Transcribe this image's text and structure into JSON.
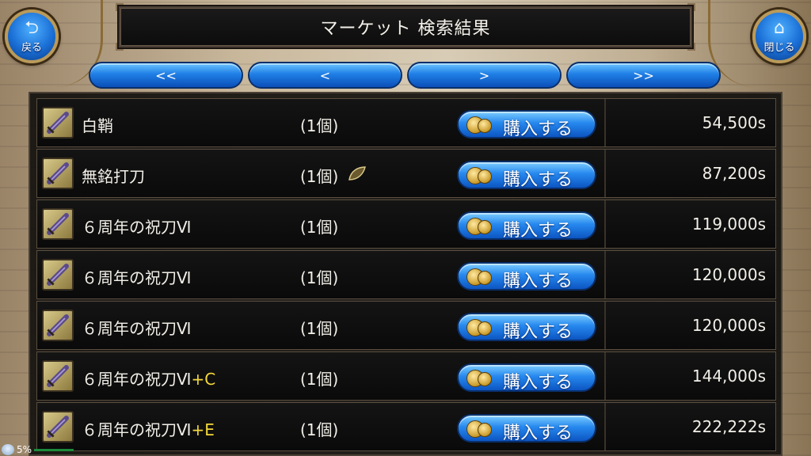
{
  "header": {
    "title": "マーケット 検索結果",
    "back_label": "戻る",
    "close_label": "閉じる"
  },
  "icons": {
    "back": "return-arrow-icon",
    "close": "home-icon",
    "item": "sword-icon",
    "coin": "coin-icon",
    "leaf": "leaf-icon"
  },
  "colors": {
    "button_blue": "#1f7fe6",
    "suffix_yellow": "#f4d83a",
    "row_bg": "#111111"
  },
  "pager": {
    "first": "<<",
    "prev": "<",
    "next": ">",
    "last": ">>"
  },
  "list": {
    "buy_label": "購入する",
    "rows": [
      {
        "name": "白鞘",
        "suffix": "",
        "qty": "(1個)",
        "price": "54,500s",
        "leaf": false
      },
      {
        "name": "無銘打刀",
        "suffix": "",
        "qty": "(1個)",
        "price": "87,200s",
        "leaf": true
      },
      {
        "name": "６周年の祝刀Ⅵ",
        "suffix": "",
        "qty": "(1個)",
        "price": "119,000s",
        "leaf": false
      },
      {
        "name": "６周年の祝刀Ⅵ",
        "suffix": "",
        "qty": "(1個)",
        "price": "120,000s",
        "leaf": false
      },
      {
        "name": "６周年の祝刀Ⅵ",
        "suffix": "",
        "qty": "(1個)",
        "price": "120,000s",
        "leaf": false
      },
      {
        "name": "６周年の祝刀Ⅵ",
        "suffix": "+C",
        "qty": "(1個)",
        "price": "144,000s",
        "leaf": false
      },
      {
        "name": "６周年の祝刀Ⅵ",
        "suffix": "+E",
        "qty": "(1個)",
        "price": "222,222s",
        "leaf": false
      }
    ]
  },
  "status": {
    "percent": "5%"
  }
}
